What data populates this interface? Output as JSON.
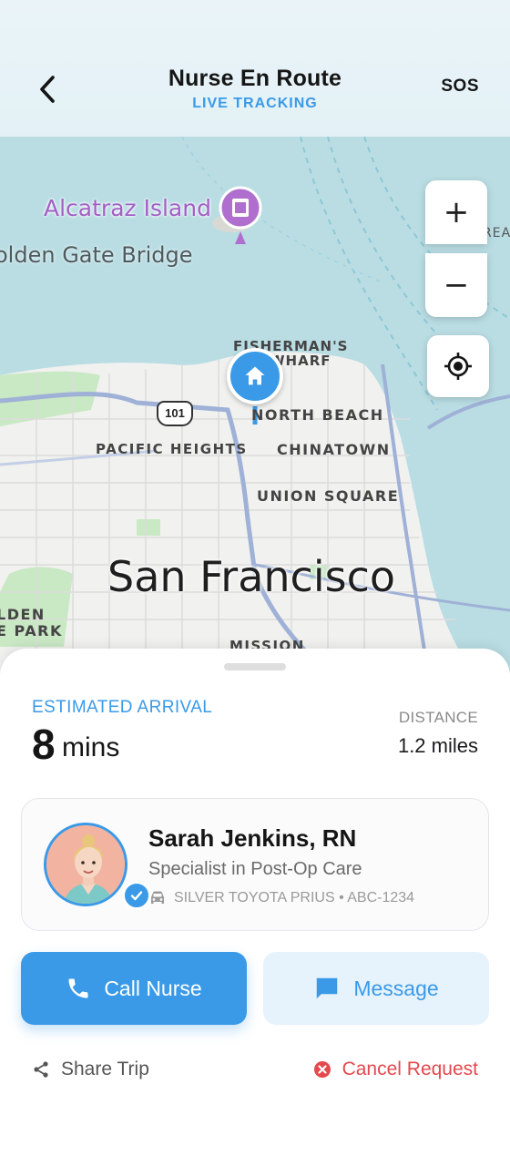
{
  "header": {
    "title": "Nurse En Route",
    "subtitle": "LIVE TRACKING",
    "sos_label": "SOS",
    "back_icon": "chevron-left-icon"
  },
  "map": {
    "labels": {
      "alcatraz": "Alcatraz Island",
      "golden_gate": "olden Gate Bridge",
      "fishermans_wharf_1": "FISHERMAN'S",
      "fishermans_wharf_2": "WHARF",
      "north_beach": "NORTH BEACH",
      "pacific_heights": "PACIFIC HEIGHTS",
      "chinatown": "CHINATOWN",
      "union_square": "UNION SQUARE",
      "city": "San Francisco",
      "den_1": "LDEN",
      "den_2": "E PARK",
      "mission": "MISSION",
      "rea": "REA",
      "highway": "101"
    },
    "controls": {
      "zoom_in": "+",
      "zoom_out": "−"
    },
    "colors": {
      "water": "#b9dde3",
      "land": "#f1f1ef",
      "park": "#c9e8c4",
      "road": "#9fb1d6"
    }
  },
  "trip": {
    "eta_label": "ESTIMATED ARRIVAL",
    "eta_value": "8",
    "eta_unit": "mins",
    "distance_label": "DISTANCE",
    "distance_value": "1.2 miles"
  },
  "nurse": {
    "name": "Sarah Jenkins, RN",
    "specialty": "Specialist in Post-Op Care",
    "vehicle": "SILVER TOYOTA PRIUS • ABC-1234"
  },
  "actions": {
    "call_label": "Call Nurse",
    "message_label": "Message",
    "share_label": "Share Trip",
    "cancel_label": "Cancel Request"
  },
  "accent": "#3a9ae8",
  "danger": "#e5484d"
}
